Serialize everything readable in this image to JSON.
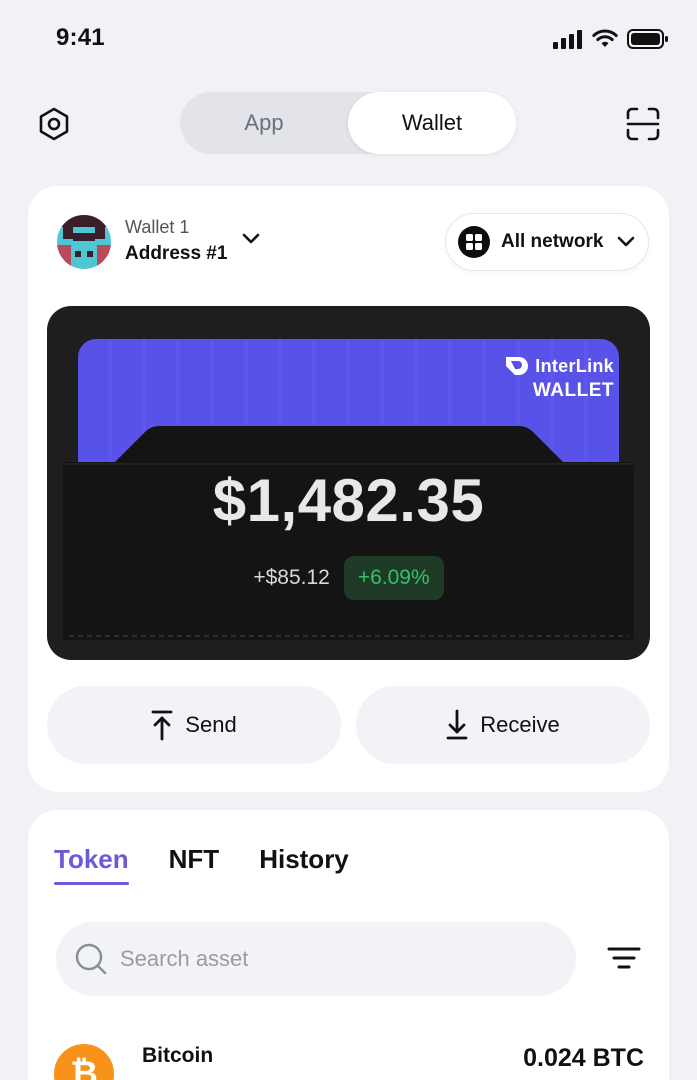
{
  "status_bar": {
    "time": "9:41",
    "icons": [
      "signal-icon",
      "wifi-icon",
      "battery-icon"
    ]
  },
  "header": {
    "segments": [
      {
        "label": "App",
        "active": false
      },
      {
        "label": "Wallet",
        "active": true
      }
    ],
    "left_icon": "settings-hex-icon",
    "right_icon": "scan-icon"
  },
  "account": {
    "wallet_name": "Wallet 1",
    "address_label": "Address #1"
  },
  "network": {
    "label": "All network"
  },
  "wallet_card": {
    "brand_name": "InterLink",
    "brand_sub": "WALLET",
    "balance": "$1,482.35",
    "change_abs": "+$85.12",
    "change_pct": "+6.09%"
  },
  "actions": {
    "send_label": "Send",
    "receive_label": "Receive"
  },
  "assets": {
    "tabs": [
      {
        "label": "Token",
        "active": true
      },
      {
        "label": "NFT",
        "active": false
      },
      {
        "label": "History",
        "active": false
      }
    ],
    "search_placeholder": "Search asset",
    "rows": [
      {
        "name": "Bitcoin",
        "amount": "0.024 BTC",
        "logo_symbol": "₿"
      }
    ]
  },
  "colors": {
    "accent": "#6a5bd8",
    "card_purple": "#5852e8",
    "positive": "#32c26a",
    "bitcoin_orange": "#f7931a"
  }
}
